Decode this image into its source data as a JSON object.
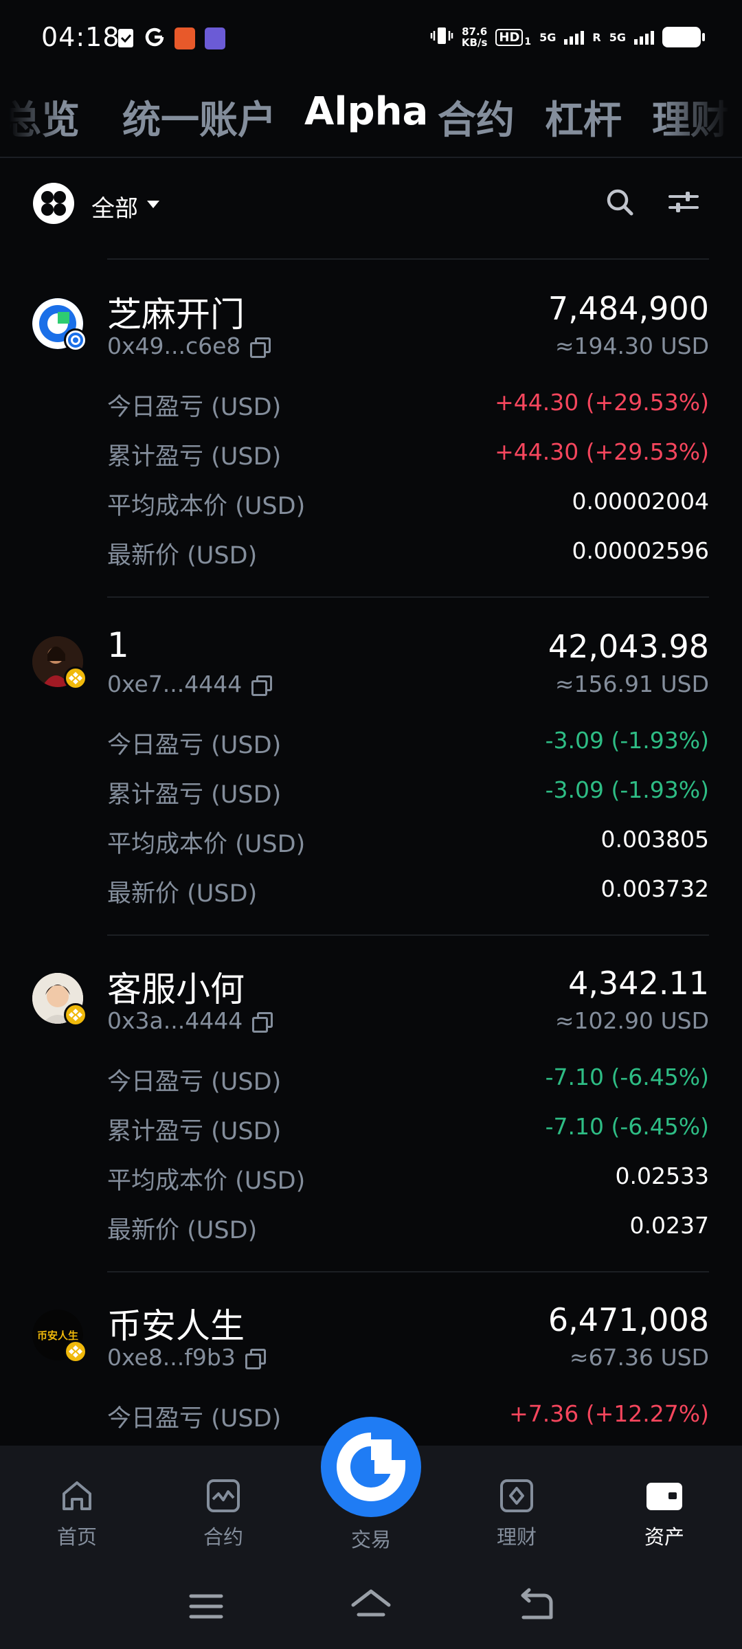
{
  "status_bar": {
    "time": "04:18",
    "net_speed_value": "87.6",
    "net_speed_unit": "KB/s",
    "hd_label": "HD",
    "hd_sub": "1",
    "sig1": "5G",
    "sig2_prefix": "R",
    "sig2": "5G"
  },
  "tabs": [
    {
      "label": "总览"
    },
    {
      "label": "统一账户"
    },
    {
      "label": "Alpha"
    },
    {
      "label": "合约"
    },
    {
      "label": "杠杆"
    },
    {
      "label": "理财"
    }
  ],
  "filter": {
    "label": "全部"
  },
  "row_labels": {
    "today_pnl": "今日盈亏 (USD)",
    "total_pnl": "累计盈亏 (USD)",
    "avg_cost": "平均成本价 (USD)",
    "last_price": "最新价 (USD)"
  },
  "assets": [
    {
      "name": "芝麻开门",
      "address": "0x49...c6e8",
      "quantity": "7,484,900",
      "usd_value": "≈194.30 USD",
      "today_pnl": "+44.30 (+29.53%)",
      "total_pnl": "+44.30 (+29.53%)",
      "avg_cost": "0.00002004",
      "last_price": "0.00002596"
    },
    {
      "name": "1",
      "address": "0xe7...4444",
      "quantity": "42,043.98",
      "usd_value": "≈156.91 USD",
      "today_pnl": "-3.09 (-1.93%)",
      "total_pnl": "-3.09 (-1.93%)",
      "avg_cost": "0.003805",
      "last_price": "0.003732"
    },
    {
      "name": "客服小何",
      "address": "0x3a...4444",
      "quantity": "4,342.11",
      "usd_value": "≈102.90 USD",
      "today_pnl": "-7.10 (-6.45%)",
      "total_pnl": "-7.10 (-6.45%)",
      "avg_cost": "0.02533",
      "last_price": "0.0237"
    },
    {
      "name": "币安人生",
      "avatar_text": "币安人生",
      "address": "0xe8...f9b3",
      "quantity": "6,471,008",
      "usd_value": "≈67.36 USD",
      "today_pnl": "+7.36 (+12.27%)"
    }
  ],
  "bottom_nav": {
    "home": "首页",
    "futures": "合约",
    "trade": "交易",
    "earn": "理财",
    "assets": "资产"
  },
  "colors": {
    "background": "#07080a",
    "positive": "#f6465d",
    "negative": "#2ebd85",
    "accent": "#1f7cf4",
    "muted": "#848e9c"
  }
}
